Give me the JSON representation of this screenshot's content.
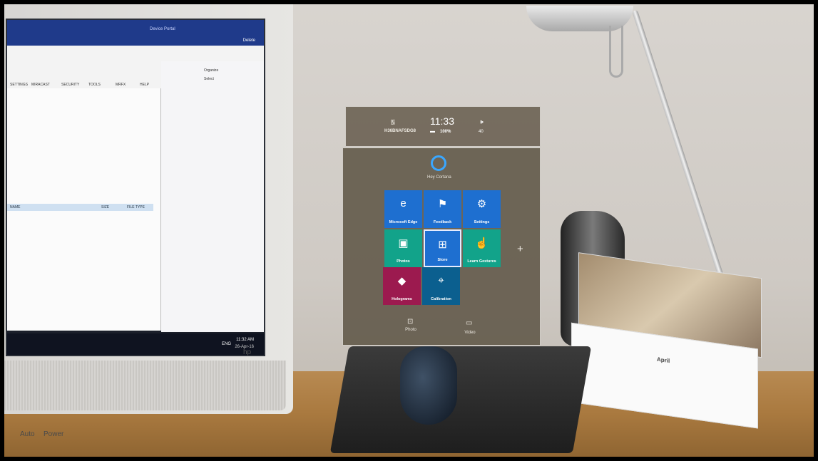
{
  "monitor": {
    "window_title": "Device Portal",
    "user_button": "Delete",
    "ribbon_items": [
      "SETTINGS",
      "MIRACAST",
      "SECURITY",
      "TOOLS",
      "MRFX",
      "HELP"
    ],
    "right_panel_items": [
      "Organize",
      "Select"
    ],
    "table_headers": [
      "NAME",
      "SIZE",
      "FILE TYPE"
    ],
    "taskbar_time": "11:32 AM",
    "taskbar_date": "26-Apr-16",
    "taskbar_lang": "ENG",
    "brand": "hp",
    "bottom_labels": {
      "auto": "Auto",
      "power": "Power"
    }
  },
  "hologram": {
    "status": {
      "wifi_icon": "wifi-icon",
      "ssid": "H36BNAFSDG8",
      "time": "11:33",
      "battery_icon": "battery-icon",
      "battery": "100%",
      "volume_icon": "speaker-icon",
      "volume": "40"
    },
    "cortana": {
      "label": "Hey Cortana"
    },
    "tiles": [
      {
        "label": "Microsoft Edge",
        "icon": "edge-icon",
        "glyph": "e",
        "color": "#1e6fd0"
      },
      {
        "label": "Feedback",
        "icon": "feedback-icon",
        "glyph": "⚑",
        "color": "#1e6fd0"
      },
      {
        "label": "Settings",
        "icon": "gear-icon",
        "glyph": "⚙",
        "color": "#1e6fd0"
      },
      {
        "label": "Photos",
        "icon": "photos-icon",
        "glyph": "▣",
        "color": "#12a38a"
      },
      {
        "label": "Store",
        "icon": "store-icon",
        "glyph": "⊞",
        "color": "#1e6fd0"
      },
      {
        "label": "Learn Gestures",
        "icon": "hand-icon",
        "glyph": "☝",
        "color": "#12a38a"
      },
      {
        "label": "Holograms",
        "icon": "holograms-icon",
        "glyph": "◆",
        "color": "#9c1a4f"
      },
      {
        "label": "Calibration",
        "icon": "calibration-icon",
        "glyph": "⌖",
        "color": "#0b5f8f"
      }
    ],
    "plus_glyph": "+",
    "bottom": [
      {
        "label": "Photo",
        "icon": "camera-icon",
        "glyph": "⊡"
      },
      {
        "label": "Video",
        "icon": "video-icon",
        "glyph": "▭"
      }
    ]
  },
  "calendar": {
    "month": "April"
  }
}
